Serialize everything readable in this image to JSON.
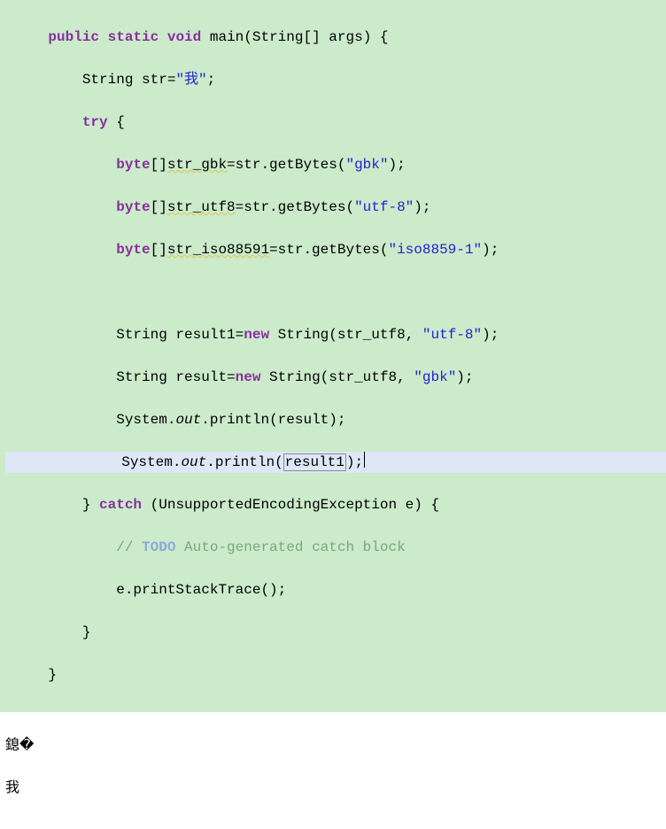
{
  "code": {
    "l1": {
      "kw1": "public",
      "kw2": "static",
      "kw3": "void",
      "name": "main",
      "paren_open": "(",
      "type": "String",
      "brackets": "[]",
      "param": " args",
      "paren_close": ") {"
    },
    "l2": {
      "type": "String",
      "var": " str",
      "eq": "=",
      "val": "\"我\"",
      "semi": ";"
    },
    "l3": {
      "kw": "try",
      "brace": " {"
    },
    "l4": {
      "type": "byte",
      "brackets": "[]",
      "var": "str_gbk",
      "eq": "=str.getBytes(",
      "arg": "\"gbk\"",
      "close": ");"
    },
    "l5": {
      "type": "byte",
      "brackets": "[]",
      "var": "str_utf8",
      "eq": "=str.getBytes(",
      "arg": "\"utf-8\"",
      "close": ");"
    },
    "l6": {
      "type": "byte",
      "brackets": "[]",
      "var": "str_iso88591",
      "eq": "=str.getBytes(",
      "arg": "\"iso8859-1\"",
      "close": ");"
    },
    "l7": " ",
    "l8": {
      "pre": "String result1=",
      "kw": "new",
      "mid": " String(str_utf8, ",
      "arg": "\"utf-8\"",
      "close": ");"
    },
    "l9": {
      "pre": "String result=",
      "kw": "new",
      "mid": " String(str_utf8, ",
      "arg": "\"gbk\"",
      "close": ");"
    },
    "l10": {
      "pre": "System.",
      "out": "out",
      "mid": ".println(result);"
    },
    "l11": {
      "pre": "System.",
      "out": "out",
      "mid": ".println(",
      "arg": "result1",
      "close": ");"
    },
    "l12": {
      "close": "} ",
      "kw": "catch",
      "open": " (UnsupportedEncodingException e) {"
    },
    "l13": {
      "cm_pre": "// ",
      "todo": "TODO",
      "cm_rest": " Auto-generated catch block"
    },
    "l14": "e.printStackTrace();",
    "l15": "}",
    "l16": "}"
  },
  "console": {
    "line1": "鎴�",
    "line2": "我"
  }
}
